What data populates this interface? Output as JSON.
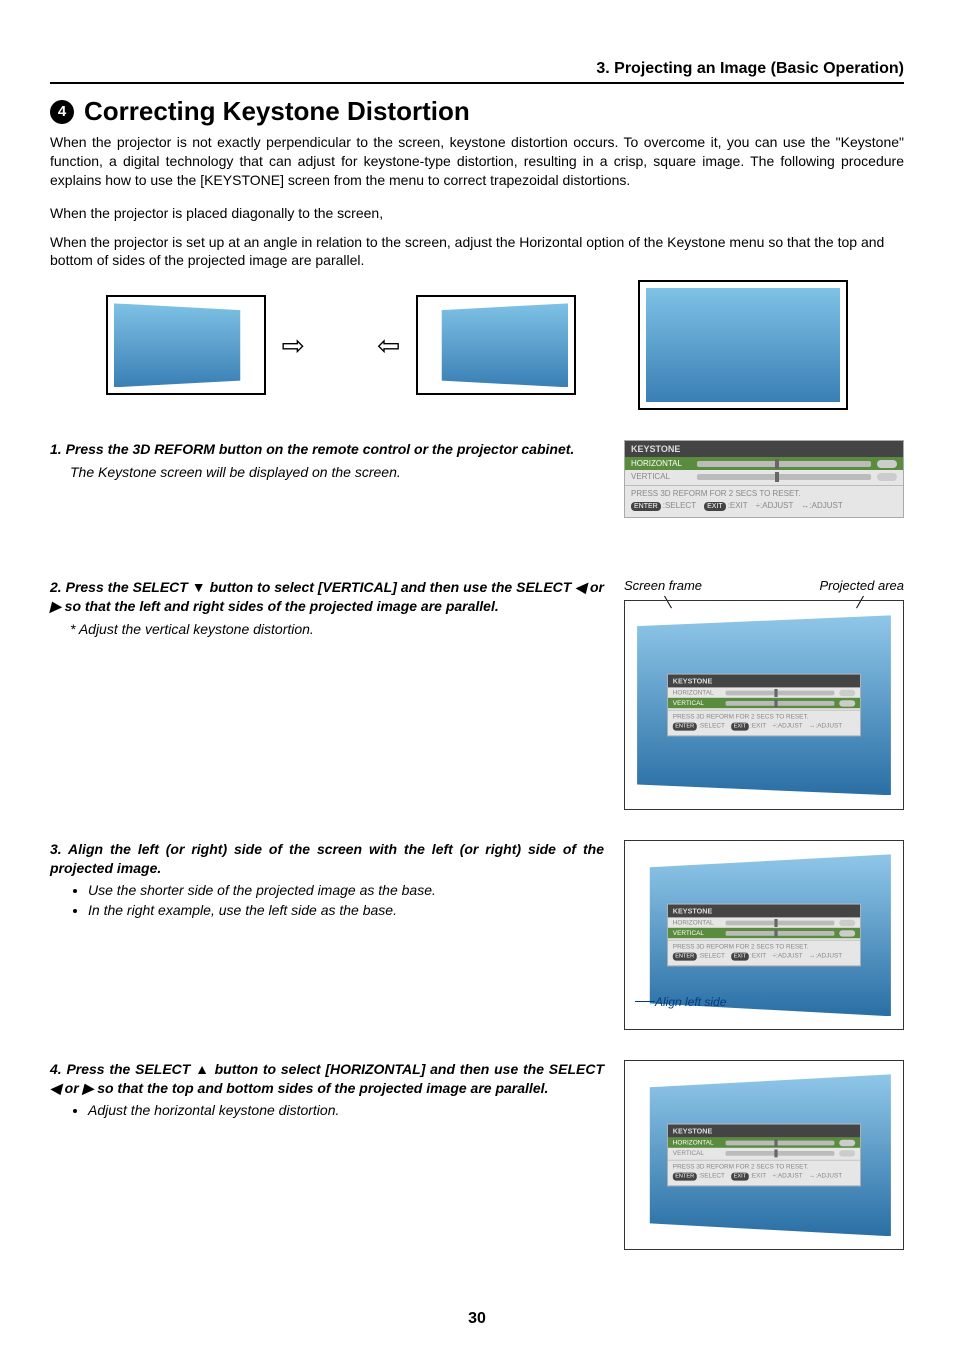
{
  "chapter_header": "3. Projecting an Image (Basic Operation)",
  "section_number": "4",
  "section_title": "Correcting Keystone Distortion",
  "intro": "When the projector is not exactly perpendicular to the screen, keystone distortion occurs. To overcome it, you can use the \"Keystone\" function, a digital technology that can adjust for keystone-type distortion, resulting in a crisp, square image. The following procedure explains how to use the [KEYSTONE] screen from the menu to correct trapezoidal distortions.",
  "diag_intro_1": "When the projector is placed diagonally to the screen,",
  "diag_intro_2": "When the projector is set up at an angle in relation to the screen, adjust the Horizontal option of the Keystone menu so that the top and bottom of sides of the projected image are parallel.",
  "step1": {
    "title": "1. Press the 3D REFORM button on the remote control or the projector cabinet.",
    "sub": "The Keystone screen will be displayed on the screen."
  },
  "osd": {
    "title": "KEYSTONE",
    "row_h": "HORIZONTAL",
    "row_v": "VERTICAL",
    "reset_hint": "PRESS 3D REFORM FOR 2 SECS TO RESET.",
    "hint_enter_btn": "ENTER",
    "hint_enter": ":SELECT",
    "hint_exit_btn": "EXIT",
    "hint_exit": ":EXIT",
    "hint_v": "÷:ADJUST",
    "hint_h": "↔:ADJUST"
  },
  "step2": {
    "title": "2. Press the SELECT ▼ button to select [VERTICAL] and then use the SELECT ◀ or ▶ so that the left and right sides of the projected image are parallel.",
    "sub": "* Adjust the vertical keystone distortion.",
    "label_screen": "Screen frame",
    "label_proj": "Projected area"
  },
  "step3": {
    "title": "3. Align the left (or right) side of the screen with the left (or right) side of the projected image.",
    "bullet1": "Use the shorter side of the projected image as the base.",
    "bullet2": "In the right example, use the left side as the base.",
    "align_label": "Align left side"
  },
  "step4": {
    "title": "4. Press the SELECT ▲ button to select [HORIZONTAL] and then use the SELECT ◀ or ▶ so that the top and bottom sides of the projected image are parallel.",
    "bullet1": "Adjust the horizontal keystone distortion."
  },
  "page_number": "30"
}
